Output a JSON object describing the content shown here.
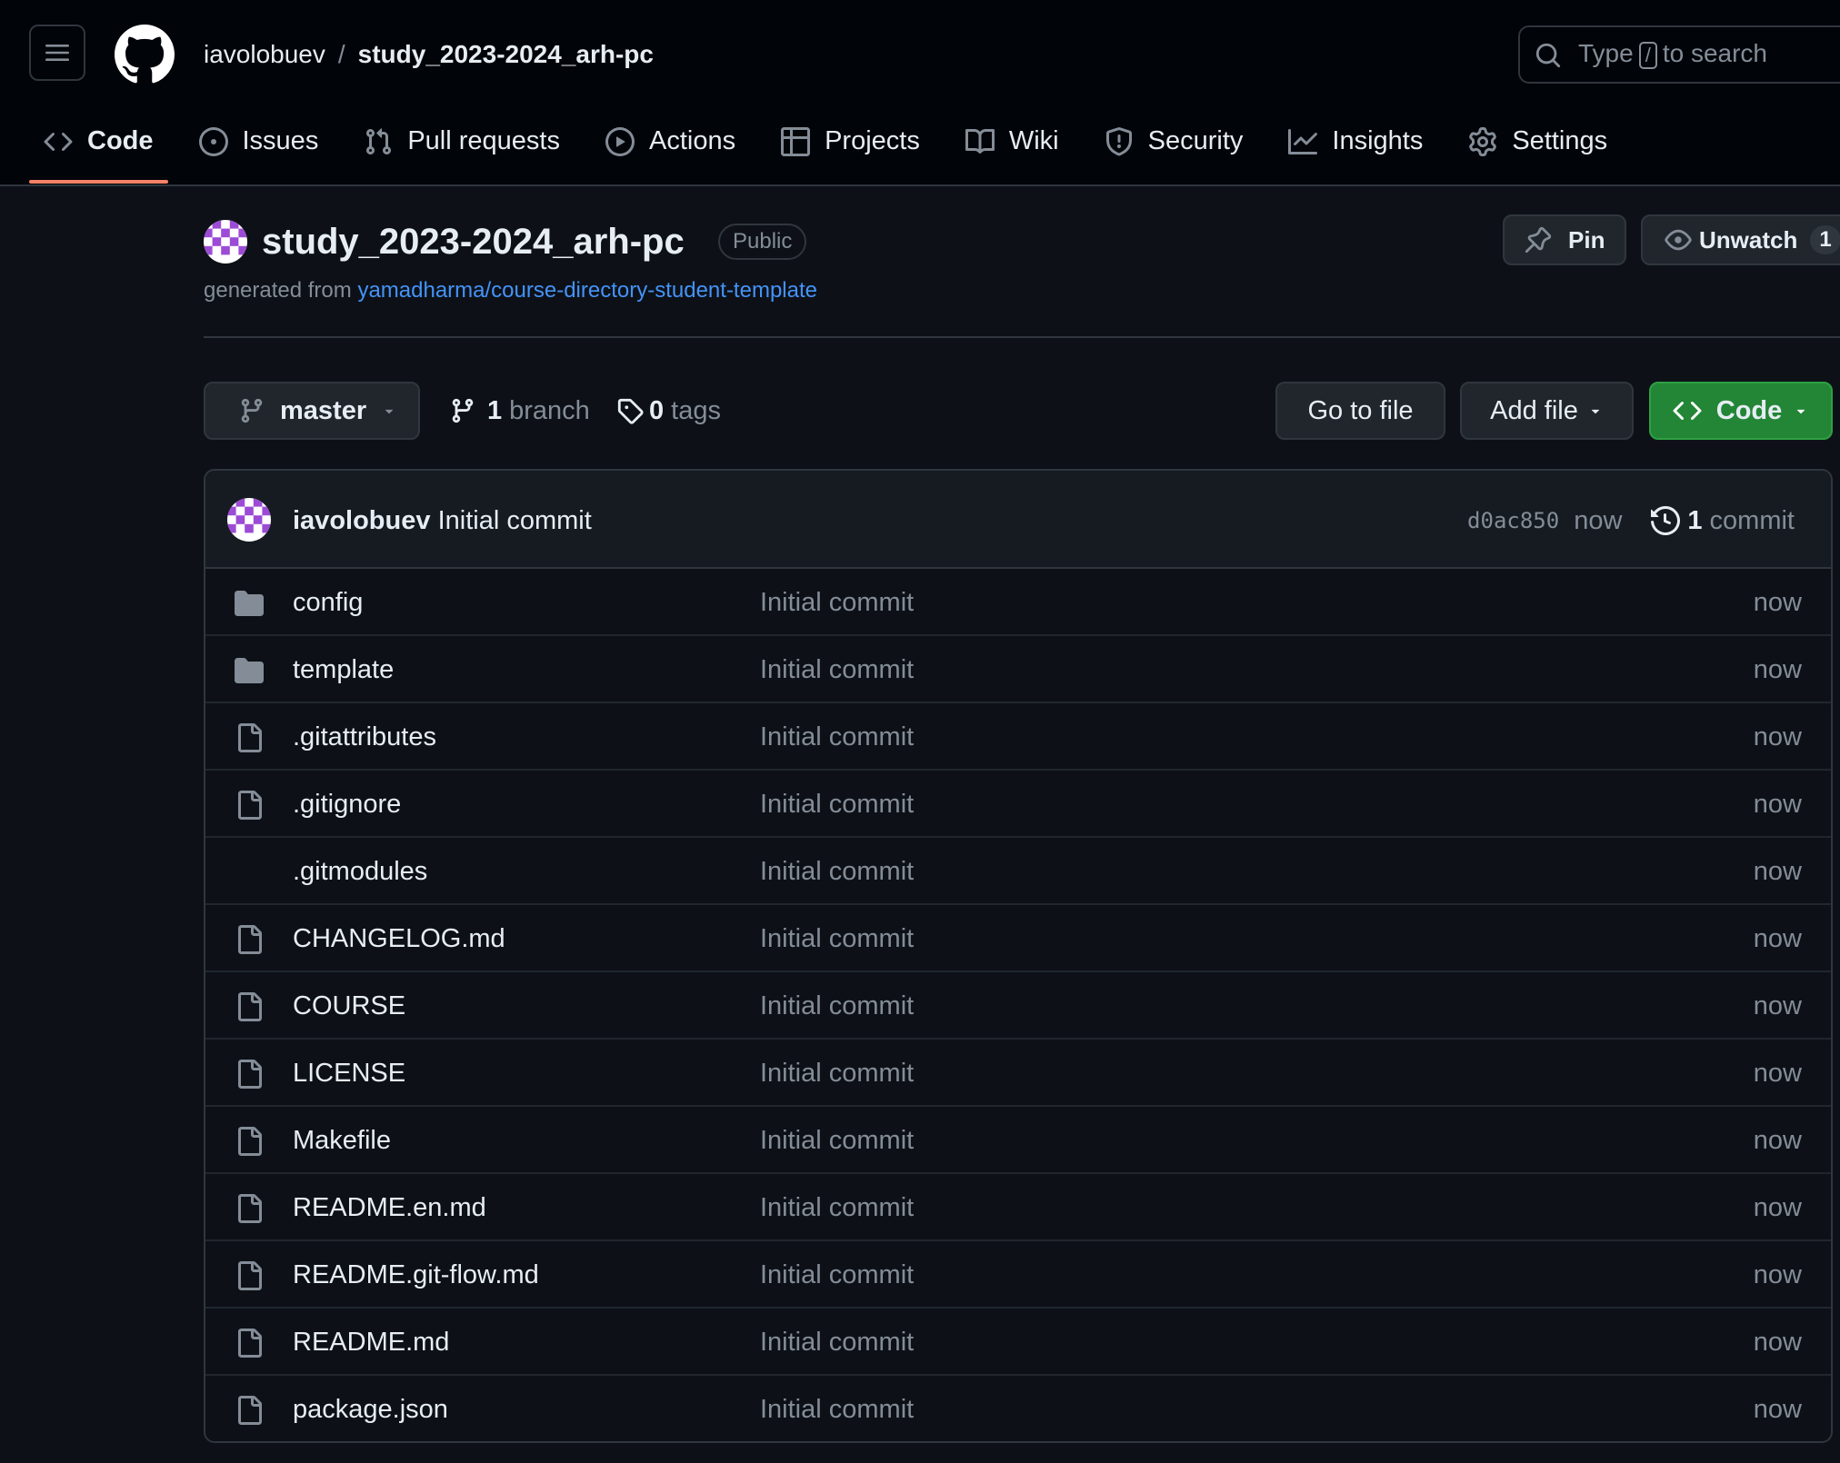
{
  "header": {
    "owner": "iavolobuev",
    "separator": "/",
    "repo": "study_2023-2024_arh-pc",
    "search": {
      "prefix": "Type",
      "key": "/",
      "suffix": "to search"
    }
  },
  "tabs": [
    {
      "label": "Code",
      "icon": "code-icon",
      "active": true
    },
    {
      "label": "Issues",
      "icon": "issue-icon"
    },
    {
      "label": "Pull requests",
      "icon": "pull-request-icon"
    },
    {
      "label": "Actions",
      "icon": "play-icon"
    },
    {
      "label": "Projects",
      "icon": "table-icon"
    },
    {
      "label": "Wiki",
      "icon": "book-icon"
    },
    {
      "label": "Security",
      "icon": "shield-icon"
    },
    {
      "label": "Insights",
      "icon": "graph-icon"
    },
    {
      "label": "Settings",
      "icon": "gear-icon"
    }
  ],
  "repo": {
    "title": "study_2023-2024_arh-pc",
    "visibility": "Public",
    "generated_prefix": "generated from",
    "template_link": "yamadharma/course-directory-student-template",
    "pin_label": "Pin",
    "watch_label": "Unwatch",
    "watch_count": "1"
  },
  "toolbar": {
    "branch": "master",
    "branch_count": "1",
    "branch_label": "branch",
    "tag_count": "0",
    "tag_label": "tags",
    "go_to_file": "Go to file",
    "add_file": "Add file",
    "code": "Code"
  },
  "commit": {
    "author": "iavolobuev",
    "message": "Initial commit",
    "sha": "d0ac850",
    "time": "now",
    "count": "1",
    "count_label": "commit"
  },
  "files": [
    {
      "name": "config",
      "type": "folder",
      "message": "Initial commit",
      "time": "now"
    },
    {
      "name": "template",
      "type": "folder",
      "message": "Initial commit",
      "time": "now"
    },
    {
      "name": ".gitattributes",
      "type": "file",
      "message": "Initial commit",
      "time": "now"
    },
    {
      "name": ".gitignore",
      "type": "file",
      "message": "Initial commit",
      "time": "now"
    },
    {
      "name": ".gitmodules",
      "type": "file",
      "message": "Initial commit",
      "time": "now"
    },
    {
      "name": "CHANGELOG.md",
      "type": "file",
      "message": "Initial commit",
      "time": "now"
    },
    {
      "name": "COURSE",
      "type": "file",
      "message": "Initial commit",
      "time": "now"
    },
    {
      "name": "LICENSE",
      "type": "file",
      "message": "Initial commit",
      "time": "now"
    },
    {
      "name": "Makefile",
      "type": "file",
      "message": "Initial commit",
      "time": "now"
    },
    {
      "name": "README.en.md",
      "type": "file",
      "message": "Initial commit",
      "time": "now"
    },
    {
      "name": "README.git-flow.md",
      "type": "file",
      "message": "Initial commit",
      "time": "now"
    },
    {
      "name": "README.md",
      "type": "file",
      "message": "Initial commit",
      "time": "now"
    },
    {
      "name": "package.json",
      "type": "file",
      "message": "Initial commit",
      "time": "now"
    }
  ],
  "colors": {
    "accent_tab": "#f78166",
    "link": "#4493f8",
    "primary_button": "#238636",
    "background": "#0d1117"
  }
}
